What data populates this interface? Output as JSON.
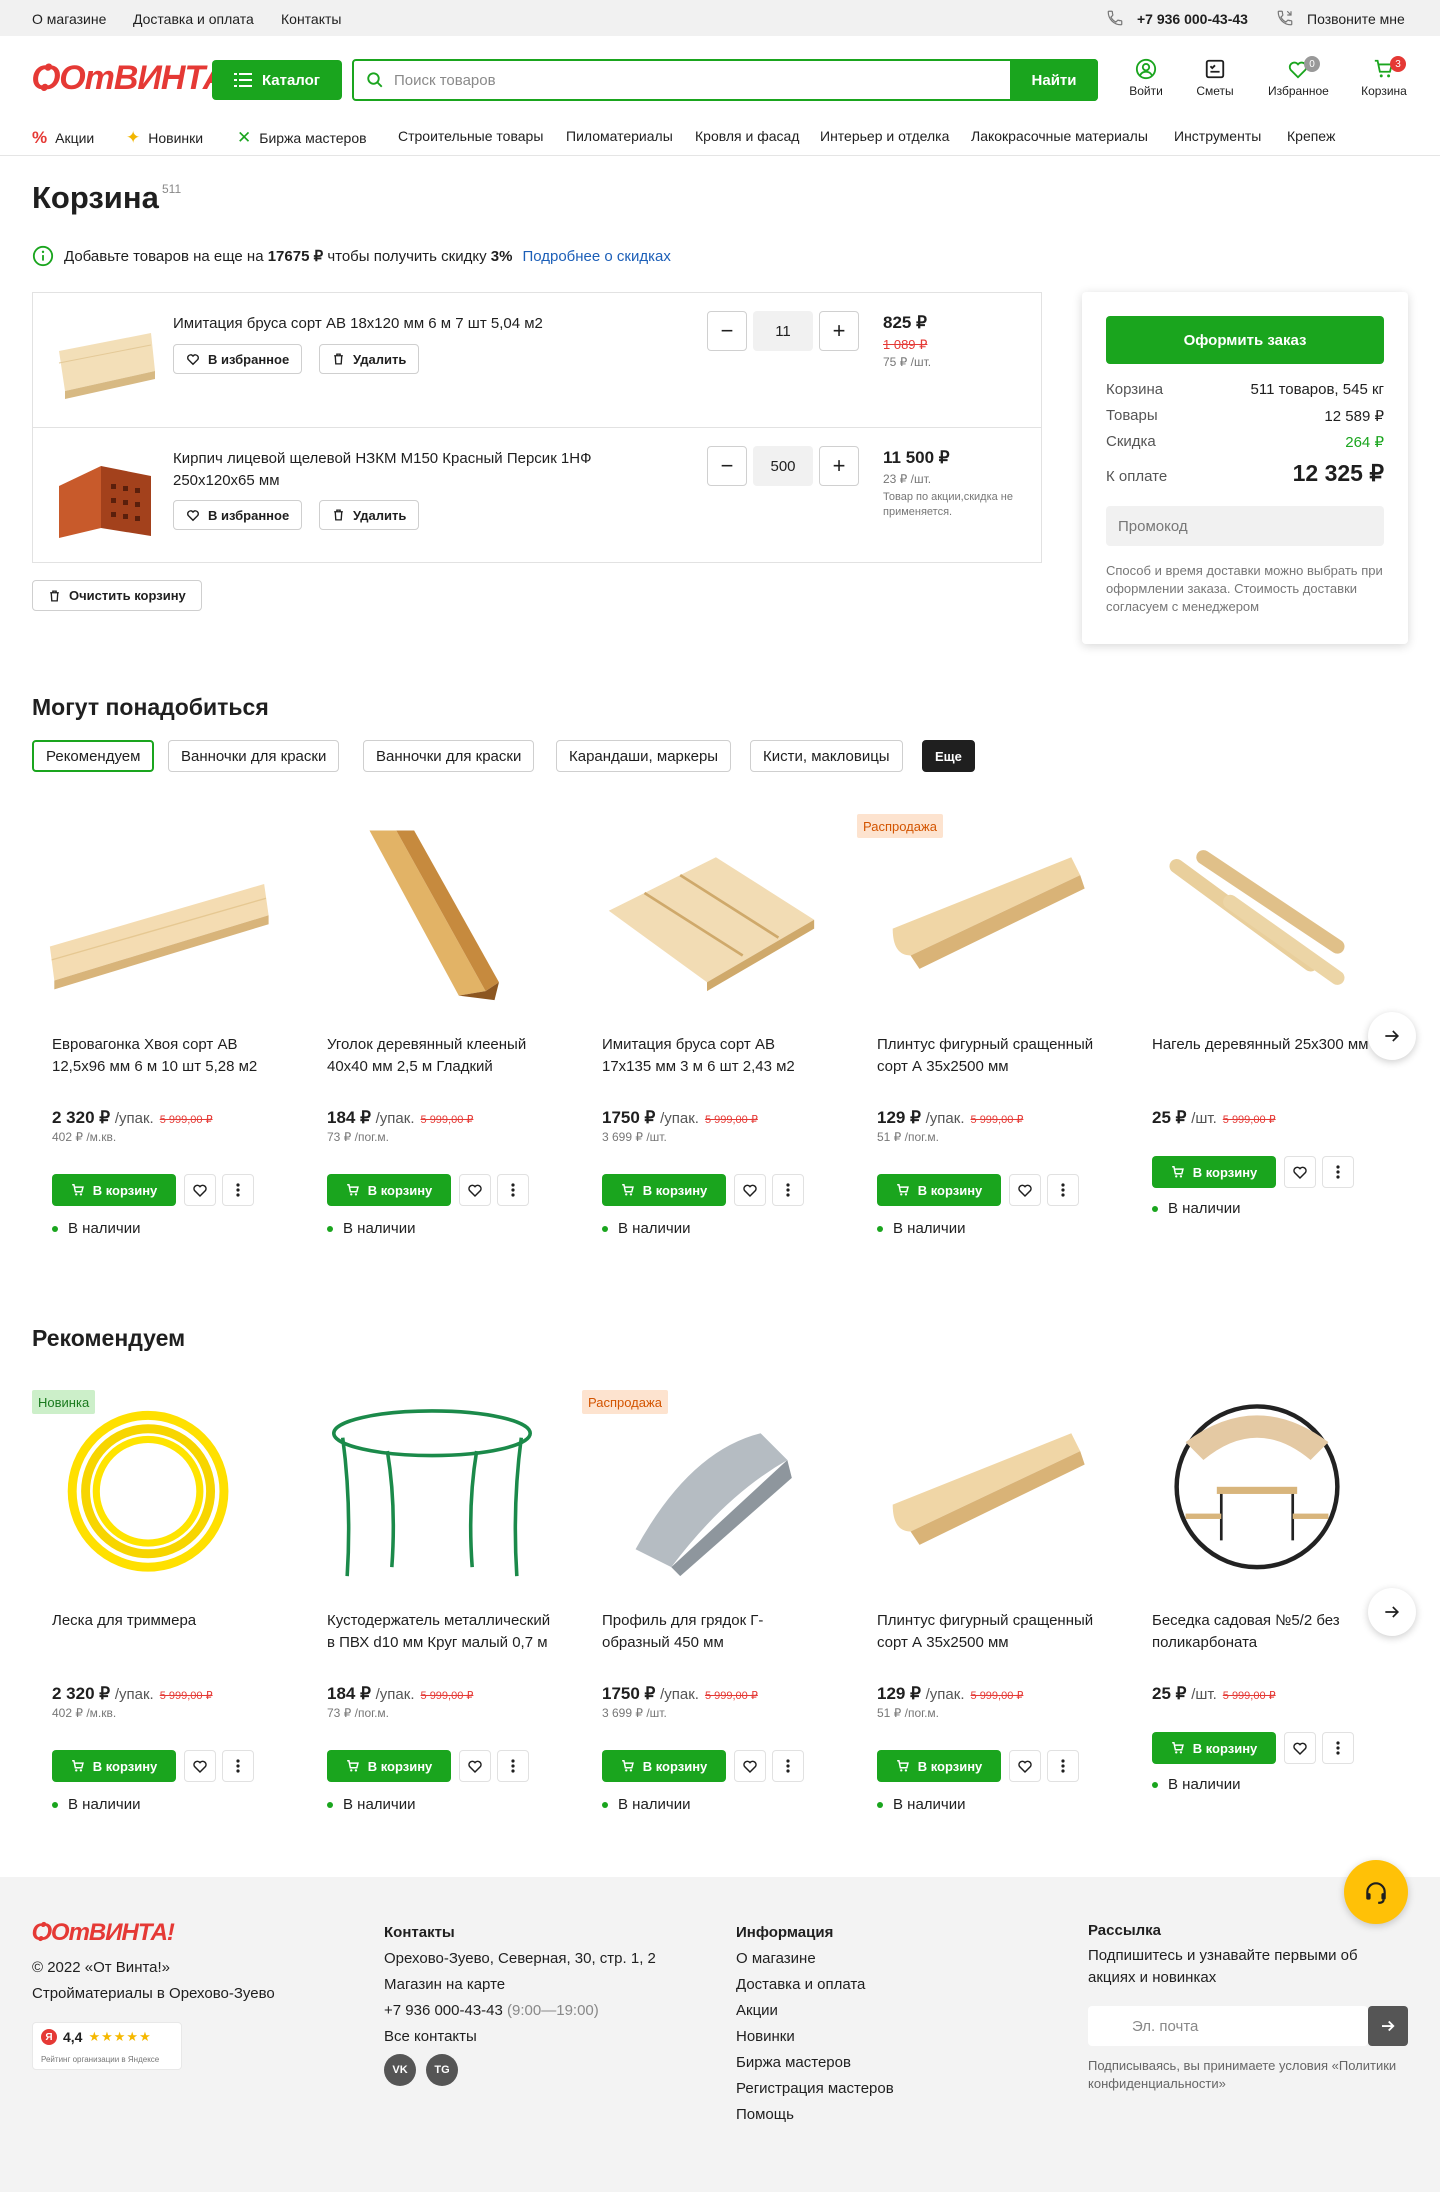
{
  "topbar": {
    "links": [
      "О магазине",
      "Доставка и оплата",
      "Контакты"
    ],
    "phone": "+7 936 000-43-43",
    "callback": "Позвоните мне"
  },
  "header": {
    "logo": "ОтВИНТА!",
    "catalog": "Каталог",
    "search_placeholder": "Поиск товаров",
    "search_button": "Найти",
    "icons": [
      {
        "label": "Войти",
        "icon": "user-icon"
      },
      {
        "label": "Сметы",
        "icon": "estimate-icon"
      },
      {
        "label": "Избранное",
        "icon": "heart-icon",
        "badge": "0"
      },
      {
        "label": "Корзина",
        "icon": "cart-icon",
        "badge": "3"
      }
    ]
  },
  "nav": [
    "Акции",
    "Новинки",
    "Биржа мастеров",
    "Строительные товары",
    "Пиломатериалы",
    "Кровля и фасад",
    "Интерьер и отделка",
    "Лакокрасочные материалы",
    "Инструменты",
    "Крепеж"
  ],
  "cart": {
    "title": "Корзина",
    "count": "511",
    "promo": {
      "before": "Добавьте товаров на еще на",
      "amount": "17675 ₽",
      "mid": "чтобы получить скидку",
      "percent": "3%",
      "link": "Подробнее о скидках"
    },
    "items": [
      {
        "title": "Имитация бруса сорт АВ 18х120 мм 6 м 7 шт 5,04 м2",
        "fav": "В избранное",
        "remove": "Удалить",
        "qty": "11",
        "price": "825 ₽",
        "old_price": "1 089 ₽",
        "unit_price": "75 ₽ /шт.",
        "note": ""
      },
      {
        "title": "Кирпич лицевой щелевой НЗКМ М150 Красный Персик 1НФ 250х120х65 мм",
        "fav": "В избранное",
        "remove": "Удалить",
        "qty": "500",
        "price": "11 500 ₽",
        "old_price": "",
        "unit_price": "23 ₽ /шт.",
        "note": "Товар по акции,скидка не применяется."
      }
    ],
    "clear": "Очистить корзину"
  },
  "summary": {
    "order_button": "Оформить заказ",
    "rows": [
      {
        "label": "Корзина",
        "value": "511 товаров, 545 кг"
      },
      {
        "label": "Товары",
        "value": "12 589 ₽"
      },
      {
        "label": "Скидка",
        "value": "264 ₽"
      }
    ],
    "total_label": "К оплате",
    "total": "12 325 ₽",
    "promo_placeholder": "Промокод",
    "note": "Способ и время доставки можно выбрать при оформлении заказа. Стоимость доставки согласуем с менеджером",
    "discount_color": "#1aa51e"
  },
  "needed": {
    "title": "Могут понадобиться",
    "chips": [
      "Рекомендуем",
      "Ванночки для краски",
      "Ванночки для краски",
      "Карандаши, маркеры",
      "Кисти, макловицы",
      "Еще"
    ],
    "cards": [
      {
        "title": "Евровагонка Хвоя сорт АВ 12,5х96 мм 6 м 10 шт 5,28 м2",
        "price": "2 320 ₽",
        "unit": "/упак.",
        "old": "5 999,00 ₽",
        "sub": "402 ₽ /м.кв.",
        "tag": ""
      },
      {
        "title": "Уголок деревянный клееный 40х40 мм 2,5 м Гладкий",
        "price": "184 ₽",
        "unit": "/упак.",
        "old": "5 999,00 ₽",
        "sub": "73 ₽ /пог.м.",
        "tag": ""
      },
      {
        "title": "Имитация бруса сорт АВ 17х135 мм 3 м 6 шт 2,43 м2",
        "price": "1750 ₽",
        "unit": "/упак.",
        "old": "5 999,00 ₽",
        "sub": "3 699 ₽ /шт.",
        "tag": ""
      },
      {
        "title": "Плинтус фигурный сращенный сорт А 35х2500 мм",
        "price": "129 ₽",
        "unit": "/упак.",
        "old": "5 999,00 ₽",
        "sub": "51 ₽ /пог.м.",
        "tag": "Распродажа"
      },
      {
        "title": "Нагель деревянный 25х300 мм",
        "price": "25 ₽",
        "unit": "/шт.",
        "old": "5 999,00 ₽",
        "sub": "",
        "tag": ""
      }
    ]
  },
  "recommend": {
    "title": "Рекомендуем",
    "cards": [
      {
        "title": "Леска для триммера",
        "price": "2 320 ₽",
        "unit": "/упак.",
        "old": "5 999,00 ₽",
        "sub": "402 ₽ /м.кв.",
        "tag": "Новинка"
      },
      {
        "title": "Кустодержатель металлический в ПВХ d10 мм Круг малый 0,7 м",
        "price": "184 ₽",
        "unit": "/упак.",
        "old": "5 999,00 ₽",
        "sub": "73 ₽ /пог.м.",
        "tag": ""
      },
      {
        "title": "Профиль для грядок Г-образный 450 мм",
        "price": "1750 ₽",
        "unit": "/упак.",
        "old": "5 999,00 ₽",
        "sub": "3 699 ₽ /шт.",
        "tag": "Распродажа"
      },
      {
        "title": "Плинтус фигурный сращенный сорт А 35х2500 мм",
        "price": "129 ₽",
        "unit": "/упак.",
        "old": "5 999,00 ₽",
        "sub": "51 ₽ /пог.м.",
        "tag": ""
      },
      {
        "title": "Беседка садовая №5/2 без поликарбоната",
        "price": "25 ₽",
        "unit": "/шт.",
        "old": "5 999,00 ₽",
        "sub": "",
        "tag": ""
      }
    ]
  },
  "card_labels": {
    "to_cart": "В корзину",
    "in_stock": "В наличии"
  },
  "footer": {
    "copyright": "© 2022 «От Винта!»",
    "tagline": "Стройматериалы в Орехово-Зуево",
    "rating": "4,4",
    "rating_caption": "Рейтинг организации в Яндексе",
    "contacts_title": "Контакты",
    "address": "Орехово-Зуево, Северная, 30, стр. 1, 2",
    "map": "Магазин на карте",
    "phone": "+7 936 000-43-43",
    "hours": "(9:00—19:00)",
    "all_contacts": "Все контакты",
    "social": [
      "VK",
      "TG"
    ],
    "info_title": "Информация",
    "info_links": [
      "О магазине",
      "Доставка и оплата",
      "Акции",
      "Новинки",
      "Биржа мастеров",
      "Регистрация мастеров",
      "Помощь"
    ],
    "news_title": "Рассылка",
    "news_text": "Подпишитесь и узнавайте первыми об акциях и новинках",
    "email_placeholder": "Эл. почта",
    "legal": "Подписываясь, вы принимаете условия «Политики конфиденциальности»"
  }
}
